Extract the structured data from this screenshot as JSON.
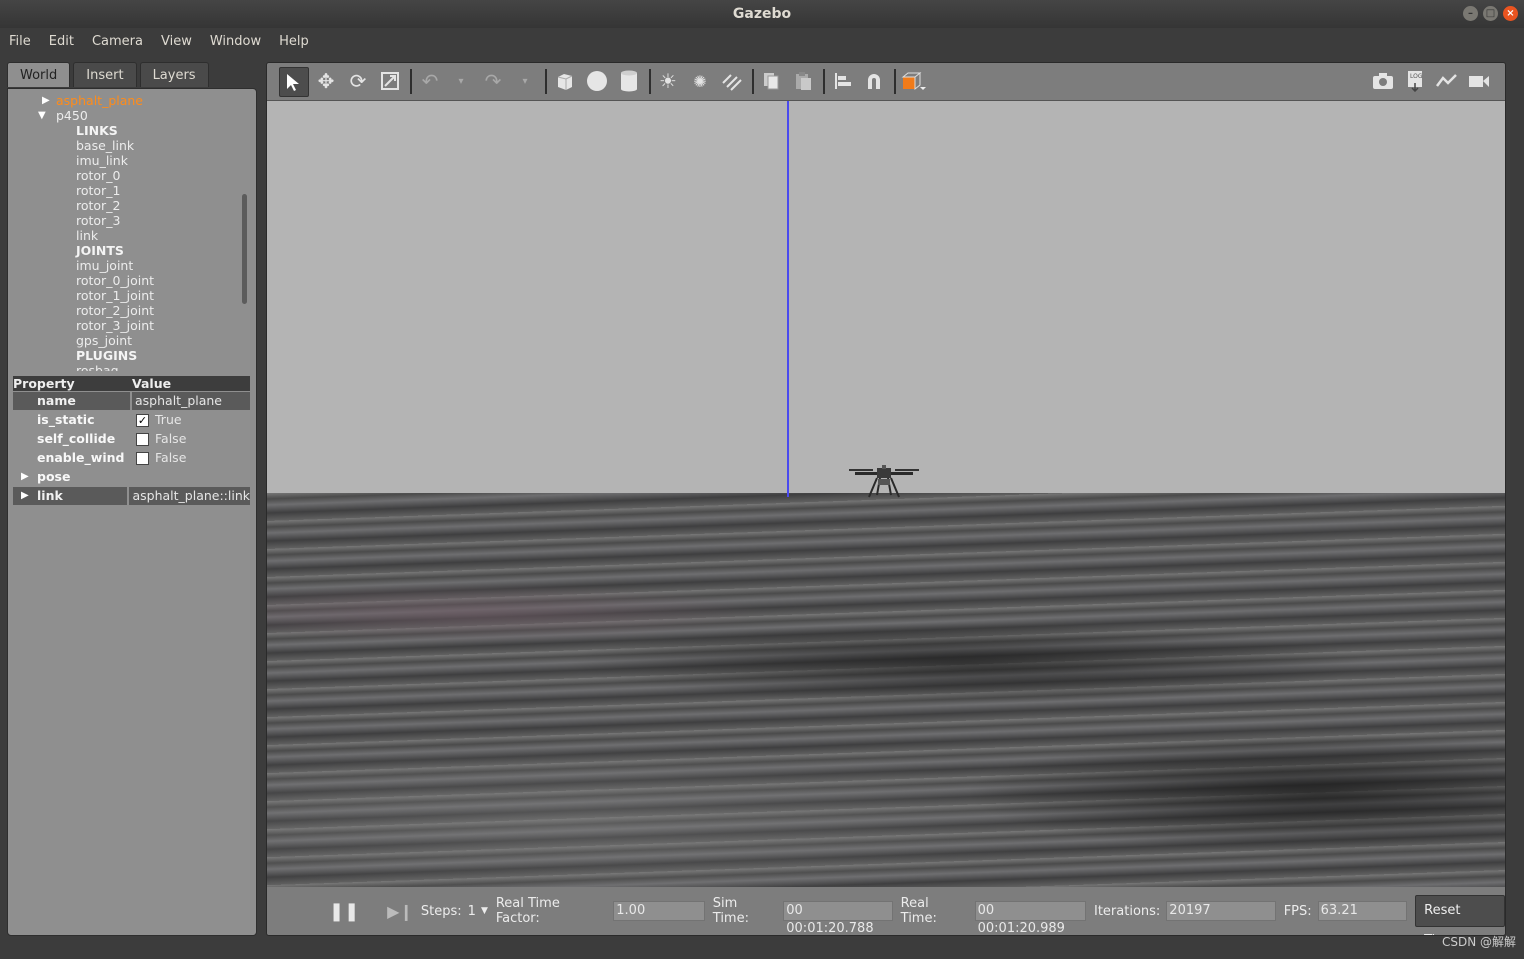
{
  "window": {
    "title": "Gazebo"
  },
  "menubar": {
    "items": [
      "File",
      "Edit",
      "Camera",
      "View",
      "Window",
      "Help"
    ]
  },
  "left_panel": {
    "tabs": [
      {
        "label": "World",
        "active": true
      },
      {
        "label": "Insert",
        "active": false
      },
      {
        "label": "Layers",
        "active": false
      }
    ],
    "tree": {
      "model_1": "asphalt_plane",
      "model_2": "p450",
      "links_header": "LINKS",
      "links": [
        "base_link",
        "imu_link",
        "rotor_0",
        "rotor_1",
        "rotor_2",
        "rotor_3",
        "link"
      ],
      "joints_header": "JOINTS",
      "joints": [
        "imu_joint",
        "rotor_0_joint",
        "rotor_1_joint",
        "rotor_2_joint",
        "rotor_3_joint",
        "gps_joint"
      ],
      "plugins_header": "PLUGINS",
      "plugins_first": "rosbag_..."
    },
    "properties": {
      "header_property": "Property",
      "header_value": "Value",
      "name_label": "name",
      "name_value": "asphalt_plane",
      "is_static_label": "is_static",
      "is_static_value": "True",
      "self_collide_label": "self_collide",
      "self_collide_value": "False",
      "enable_wind_label": "enable_wind",
      "enable_wind_value": "False",
      "pose_label": "pose",
      "link_label": "link",
      "link_value": "asphalt_plane::link"
    }
  },
  "statusbar": {
    "steps_label": "Steps:",
    "steps_value": "1",
    "rtf_label": "Real Time Factor:",
    "rtf_value": "1.00",
    "sim_time_label": "Sim Time:",
    "sim_time_value": "00 00:01:20.788",
    "real_time_label": "Real Time:",
    "real_time_value": "00 00:01:20.989",
    "iterations_label": "Iterations:",
    "iterations_value": "20197",
    "fps_label": "FPS:",
    "fps_value": "63.21",
    "reset_label": "Reset Time"
  },
  "watermark": "CSDN @解解",
  "colors": {
    "selected_model": "#ff8c1a",
    "z_axis": "#4a4aee",
    "sky": "#b4b4b4"
  }
}
